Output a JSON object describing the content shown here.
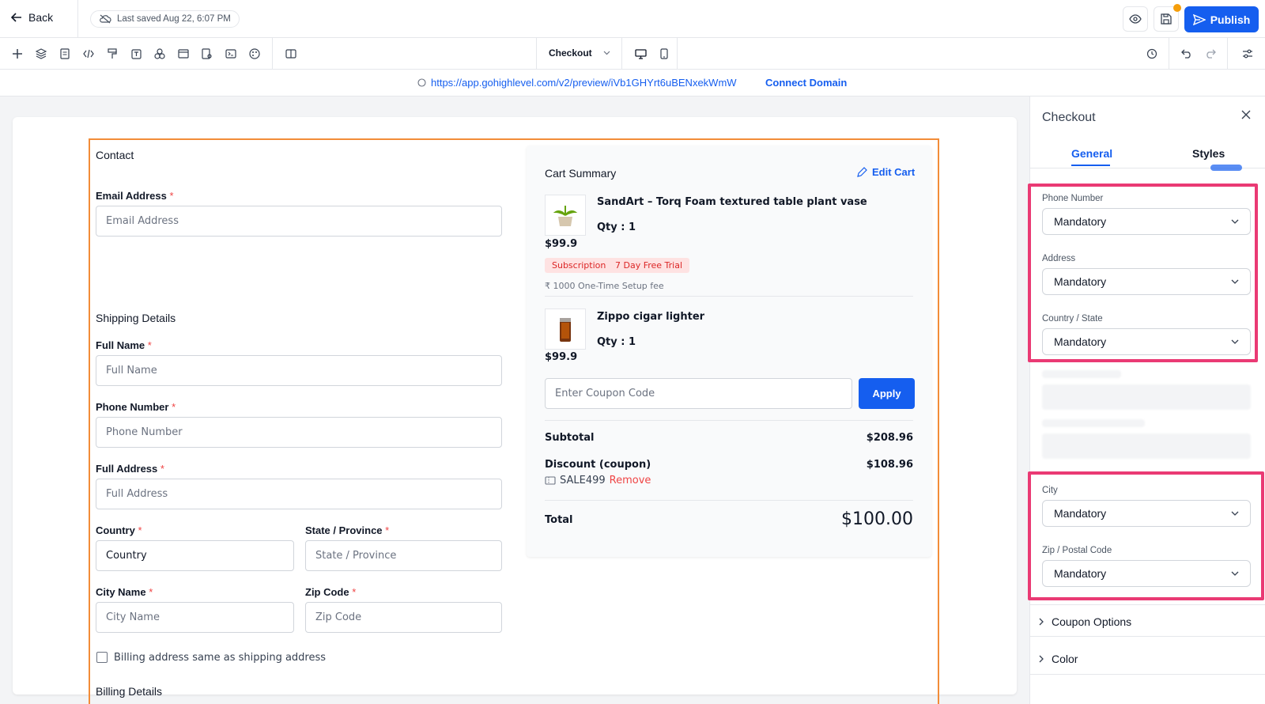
{
  "topbar": {
    "back_label": "Back",
    "saved_text": "Last saved Aug 22, 6:07 PM",
    "publish_label": "Publish"
  },
  "toolbar": {
    "page_selector": "Checkout"
  },
  "urlbar": {
    "url": "https://app.gohighlevel.com/v2/preview/iVb1GHYrt6uBENxekWmW",
    "connect_label": "Connect Domain"
  },
  "form": {
    "contact_title": "Contact",
    "email_label": "Email Address",
    "email_placeholder": "Email Address",
    "shipping_title": "Shipping Details",
    "fullname_label": "Full Name",
    "fullname_placeholder": "Full Name",
    "phone_label": "Phone Number",
    "phone_placeholder": "Phone Number",
    "address_label": "Full Address",
    "address_placeholder": "Full Address",
    "country_label": "Country",
    "country_value": "Country",
    "state_label": "State / Province",
    "state_placeholder": "State / Province",
    "city_label": "City Name",
    "city_placeholder": "City Name",
    "zip_label": "Zip Code",
    "zip_placeholder": "Zip Code",
    "billing_same_label": "Billing address same as shipping address",
    "billing_title": "Billing Details",
    "required_mark": "*"
  },
  "cart": {
    "title": "Cart Summary",
    "edit_label": "Edit Cart",
    "items": [
      {
        "name": "SandArt – Torq Foam textured table plant vase",
        "qty": "Qty : 1",
        "price": "$99.9",
        "badges": [
          "Subscription",
          "7 Day Free Trial"
        ],
        "setup_fee": "₹ 1000 One-Time Setup fee"
      },
      {
        "name": "Zippo cigar lighter",
        "qty": "Qty : 1",
        "price": "$99.9"
      }
    ],
    "coupon_placeholder": "Enter Coupon Code",
    "apply_label": "Apply",
    "subtotal_label": "Subtotal",
    "subtotal_value": "$208.96",
    "discount_label": "Discount (coupon)",
    "discount_value": "$108.96",
    "coupon_code": "SALE499",
    "remove_label": "Remove",
    "total_label": "Total",
    "total_value": "$100.00"
  },
  "panel": {
    "title": "Checkout",
    "tabs": [
      "General",
      "Styles"
    ],
    "fields": [
      {
        "label": "Phone Number",
        "value": "Mandatory"
      },
      {
        "label": "Address",
        "value": "Mandatory"
      },
      {
        "label": "Country / State",
        "value": "Mandatory"
      },
      {
        "label": "City",
        "value": "Mandatory"
      },
      {
        "label": "Zip / Postal Code",
        "value": "Mandatory"
      }
    ],
    "sections": [
      "Coupon Options",
      "Color"
    ]
  },
  "colors": {
    "primary": "#155eef",
    "frame": "#f28c38",
    "highlight": "#ea3a74",
    "required": "#ef4444"
  }
}
